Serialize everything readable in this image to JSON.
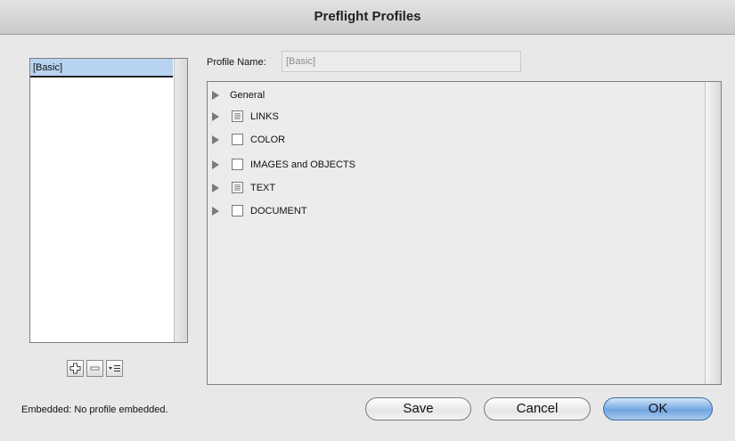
{
  "window": {
    "title": "Preflight Profiles"
  },
  "profiles_list": {
    "items": [
      "[Basic]"
    ],
    "selected": "[Basic]"
  },
  "toolbar": {
    "new_icon": "plus-icon",
    "delete_icon": "minus-icon",
    "menu_icon": "list-menu-icon"
  },
  "profile_name": {
    "label": "Profile Name:",
    "value": "[Basic]"
  },
  "tree": {
    "items": [
      {
        "label": "General",
        "has_checkbox": false,
        "state": "none"
      },
      {
        "label": "LINKS",
        "has_checkbox": true,
        "state": "mixed"
      },
      {
        "label": "COLOR",
        "has_checkbox": true,
        "state": "unchecked"
      },
      {
        "label": "IMAGES and OBJECTS",
        "has_checkbox": true,
        "state": "unchecked"
      },
      {
        "label": "TEXT",
        "has_checkbox": true,
        "state": "mixed"
      },
      {
        "label": "DOCUMENT",
        "has_checkbox": true,
        "state": "unchecked"
      }
    ]
  },
  "footer": {
    "embedded": "Embedded: No profile embedded.",
    "save_label": "Save",
    "cancel_label": "Cancel",
    "ok_label": "OK"
  },
  "colors": {
    "selection": "#b8d3f2",
    "ok_button": "#6fa6e0"
  }
}
